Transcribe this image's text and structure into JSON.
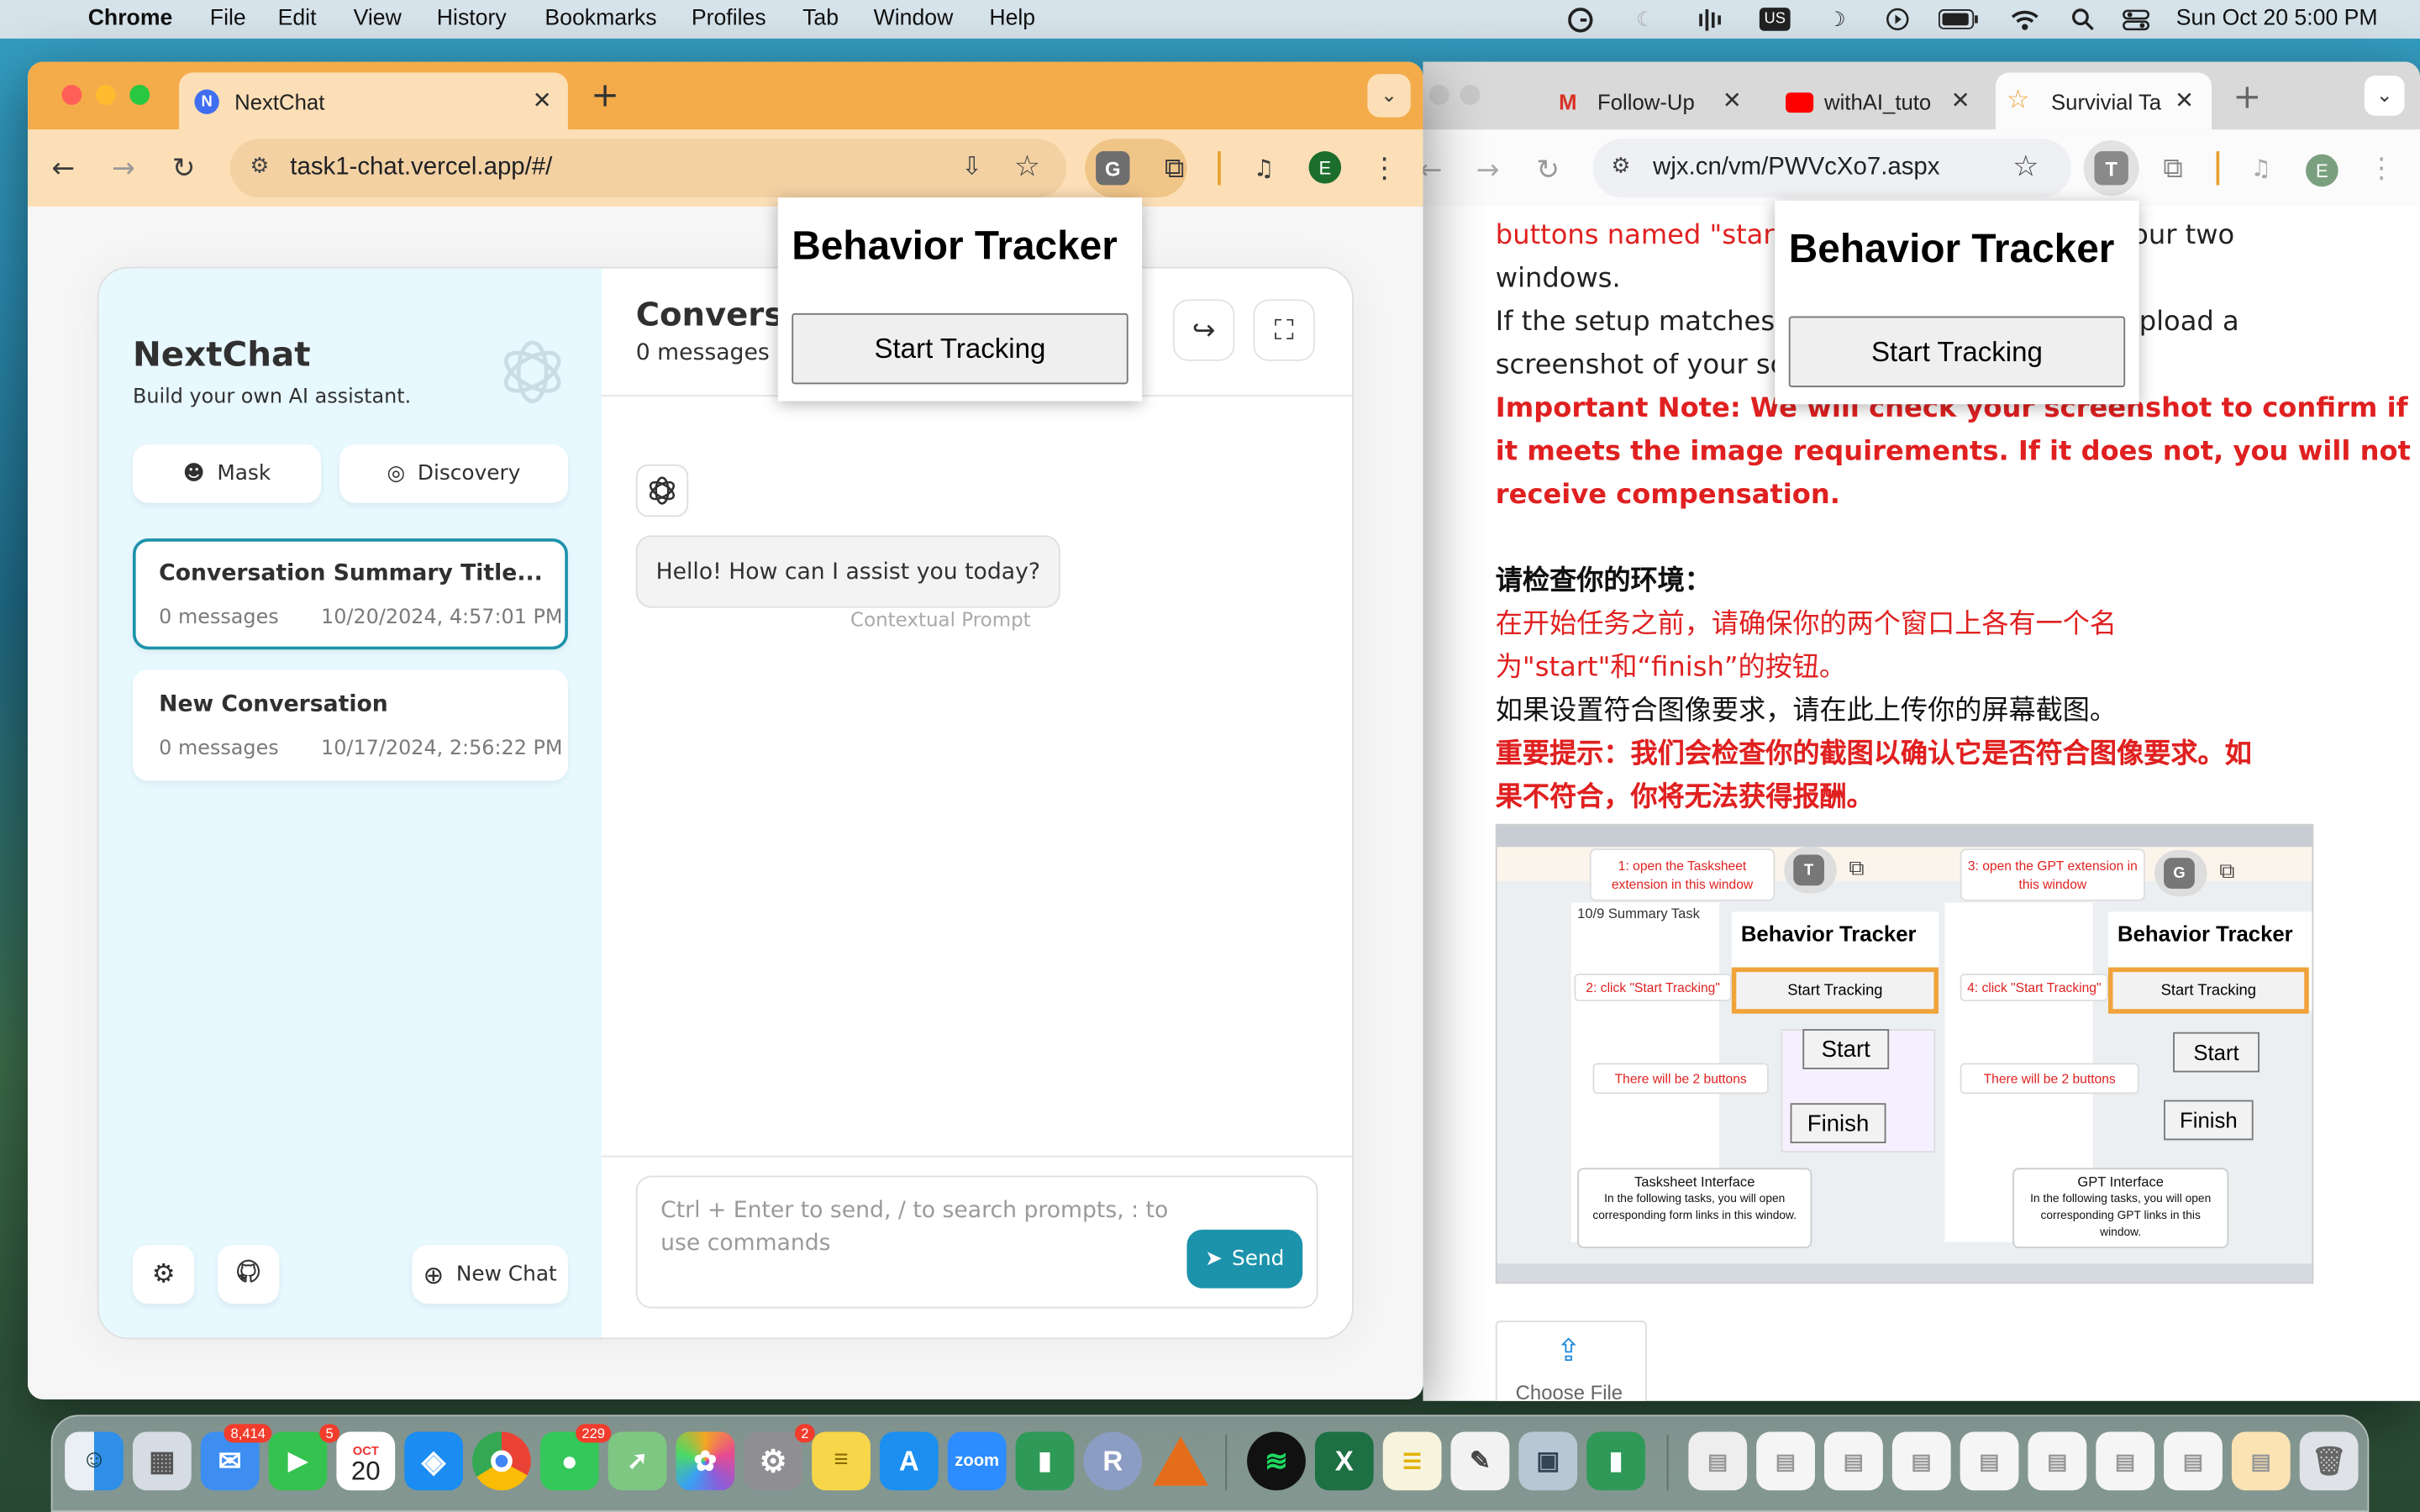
{
  "menubar": {
    "app": "Chrome",
    "items": [
      "File",
      "Edit",
      "View",
      "History",
      "Bookmarks",
      "Profiles",
      "Tab",
      "Window",
      "Help"
    ],
    "status_icon_us": "US",
    "datetime": "Sun Oct 20  5:00 PM"
  },
  "win1": {
    "tab_title": "NextChat",
    "url": "task1-chat.vercel.app/#/",
    "ext_g": "G",
    "avatar": "E"
  },
  "popup": {
    "title": "Behavior Tracker",
    "button": "Start Tracking"
  },
  "nextchat": {
    "app_title": "NextChat",
    "subtitle": "Build your own AI assistant.",
    "mask_label": "Mask",
    "discovery_label": "Discovery",
    "chats": [
      {
        "title": "Conversation Summary Title...",
        "count": "0 messages",
        "date": "10/20/2024, 4:57:01 PM"
      },
      {
        "title": "New Conversation",
        "count": "0 messages",
        "date": "10/17/2024, 2:56:22 PM"
      }
    ],
    "new_chat_label": "New Chat",
    "header_title": "Conversa",
    "header_count": "0 messages",
    "bot_message": "Hello! How can I assist you today?",
    "contextual_prompt": "Contextual Prompt",
    "input_placeholder": "Ctrl + Enter to send, / to search prompts, : to use commands",
    "send_label": "Send"
  },
  "win2": {
    "tabs": [
      {
        "title": "Follow-Up"
      },
      {
        "title": "withAI_tuto"
      },
      {
        "title": "Survivial Ta"
      }
    ],
    "url": "wjx.cn/vm/PWVcXo7.aspx",
    "ext_t": "T",
    "avatar": "E"
  },
  "page2": {
    "line1_red": "buttons named \"star",
    "line1_tail": "your two",
    "line2": "windows.",
    "line3_head": "If the setup matches",
    "line3_tail": "pload a",
    "line4": "screenshot of your sc",
    "note1": "Important Note: We will check your screenshot to confirm if",
    "note2": "it meets the image requirements. If it does not, you will not",
    "note3": "receive compensation.",
    "cn_heading": "请检查你的环境：",
    "cn_red1": "在开始任务之前，请确保你的两个窗口上各有一个名",
    "cn_red2": "为\"start\"和“finish”的按钮。",
    "cn_black": "如果设置符合图像要求，请在此上传你的屏幕截图。",
    "cn_bold1": "重要提示：我们会检查你的截图以确认它是否符合图像要求。如",
    "cn_bold2": "果不符合，你将无法获得报酬。",
    "choose_file": "Choose File"
  },
  "example": {
    "step1": "1: open the Tasksheet extension in this window",
    "step2": "2: click \"Start Tracking\"",
    "step3": "3: open the GPT extension in this window",
    "step4": "4: click \"Start Tracking\"",
    "two_buttons": "There will be 2 buttons",
    "tracker": "Behavior Tracker",
    "start_tracking": "Start Tracking",
    "start": "Start",
    "finish": "Finish",
    "summary": "10/9 Summary Task",
    "tasksheet_title": "Tasksheet Interface",
    "tasksheet_desc": "In the following tasks, you will open corresponding form links in this window.",
    "gpt_title": "GPT Interface",
    "gpt_desc": "In the following tasks, you will open corresponding GPT links in this window.",
    "t_icon": "T",
    "g_icon": "G"
  },
  "dock": {
    "mail_badge": "8,414",
    "facetime_badge": "5",
    "calendar_month": "OCT",
    "calendar_day": "20",
    "messages_badge": "229",
    "settings_badge": "2",
    "zoom_label": "zoom",
    "r_label": "R"
  }
}
